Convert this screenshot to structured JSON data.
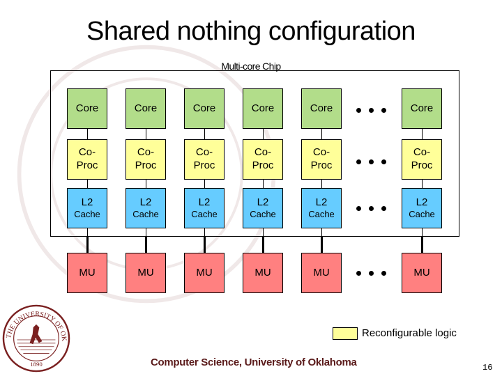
{
  "slide": {
    "title": "Shared nothing configuration",
    "chip_label": "Multi-core Chip",
    "footer": "Computer Science, University of Oklahoma",
    "page_number": "16",
    "legend": {
      "label": "Reconfigurable logic",
      "color": "#ffff99"
    }
  },
  "colors": {
    "core": "#b2dd8a",
    "coproc": "#ffff99",
    "l2": "#66ccff",
    "mu": "#ff8080",
    "footer_text": "#5a1a1a"
  },
  "columns": [
    {
      "core": "Core",
      "coproc": [
        "Co-",
        "Proc"
      ],
      "l2": [
        "L2",
        "Cache"
      ],
      "mu": "MU"
    },
    {
      "core": "Core",
      "coproc": [
        "Co-",
        "Proc"
      ],
      "l2": [
        "L2",
        "Cache"
      ],
      "mu": "MU"
    },
    {
      "core": "Core",
      "coproc": [
        "Co-",
        "Proc"
      ],
      "l2": [
        "L2",
        "Cache"
      ],
      "mu": "MU"
    },
    {
      "core": "Core",
      "coproc": [
        "Co-",
        "Proc"
      ],
      "l2": [
        "L2",
        "Cache"
      ],
      "mu": "MU"
    },
    {
      "core": "Core",
      "coproc": [
        "Co-",
        "Proc"
      ],
      "l2": [
        "L2",
        "Cache"
      ],
      "mu": "MU"
    },
    {
      "core": "Core",
      "coproc": [
        "Co-",
        "Proc"
      ],
      "l2": [
        "L2",
        "Cache"
      ],
      "mu": "MU"
    }
  ],
  "ellipsis_rows": [
    "core",
    "coproc",
    "l2",
    "mu"
  ],
  "seal": {
    "text_top": "THE UNIVERSITY OF OKLAHOMA",
    "year": "1890"
  }
}
